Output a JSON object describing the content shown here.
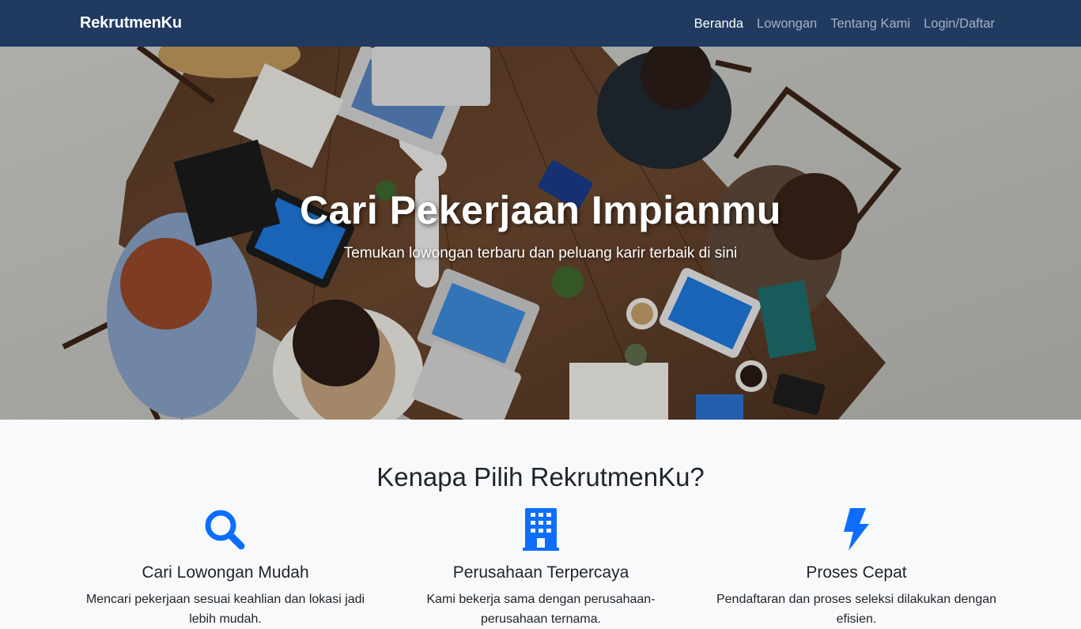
{
  "navbar": {
    "brand": "RekrutmenKu",
    "links": [
      {
        "label": "Beranda",
        "active": true
      },
      {
        "label": "Lowongan",
        "active": false
      },
      {
        "label": "Tentang Kami",
        "active": false
      },
      {
        "label": "Login/Daftar",
        "active": false
      }
    ]
  },
  "hero": {
    "title": "Cari Pekerjaan Impianmu",
    "subtitle": "Temukan lowongan terbaru dan peluang karir terbaik di sini"
  },
  "features": {
    "heading": "Kenapa Pilih RekrutmenKu?",
    "items": [
      {
        "icon": "search-icon",
        "title": "Cari Lowongan Mudah",
        "text": "Mencari pekerjaan sesuai keahlian dan lokasi jadi lebih mudah."
      },
      {
        "icon": "building-icon",
        "title": "Perusahaan Terpercaya",
        "text": "Kami bekerja sama dengan perusahaan-perusahaan ternama."
      },
      {
        "icon": "lightning-icon",
        "title": "Proses Cepat",
        "text": "Pendaftaran dan proses seleksi dilakukan dengan efisien."
      }
    ]
  },
  "colors": {
    "navbar_bg": "#203a60",
    "accent": "#0d6efd",
    "section_bg": "#f8f9fa"
  }
}
